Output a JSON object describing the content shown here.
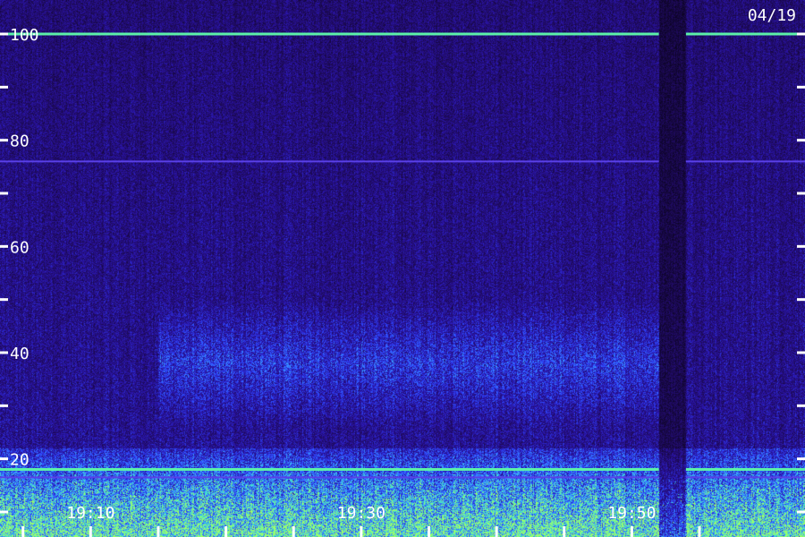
{
  "date_label": "04/19",
  "chart_data": {
    "type": "heatmap",
    "title": "",
    "xlabel": "",
    "ylabel": "",
    "x_tick_labels": [
      "19:10",
      "19:30",
      "19:50"
    ],
    "x_tick_times": [
      "19:10",
      "19:30",
      "19:50"
    ],
    "x_range": [
      "19:04",
      "19:58"
    ],
    "x_minor_tick_step_min": 5,
    "y_tick_labels": [
      "20",
      "40",
      "60",
      "80",
      "100"
    ],
    "y_tick_values": [
      20,
      40,
      60,
      80,
      100
    ],
    "y_minor_tick_step": 10,
    "ylim": [
      0,
      106
    ],
    "tick_color": "#ffffff",
    "palette": [
      "#000000",
      "#1e0a5a",
      "#2a14a8",
      "#2e48ff",
      "#3aa0ff",
      "#44e8c8",
      "#9cff6a"
    ],
    "steady_lines": [
      {
        "freq": 100,
        "intensity": "high"
      },
      {
        "freq": 76,
        "intensity": "medium"
      },
      {
        "freq": 18,
        "intensity": "high"
      },
      {
        "freq": 16.5,
        "intensity": "medium"
      }
    ],
    "elevated_band": {
      "freq_range": [
        26,
        50
      ],
      "time_range": [
        "19:15",
        "19:52"
      ]
    },
    "dropout_time_range": [
      "19:52",
      "19:54"
    ]
  }
}
